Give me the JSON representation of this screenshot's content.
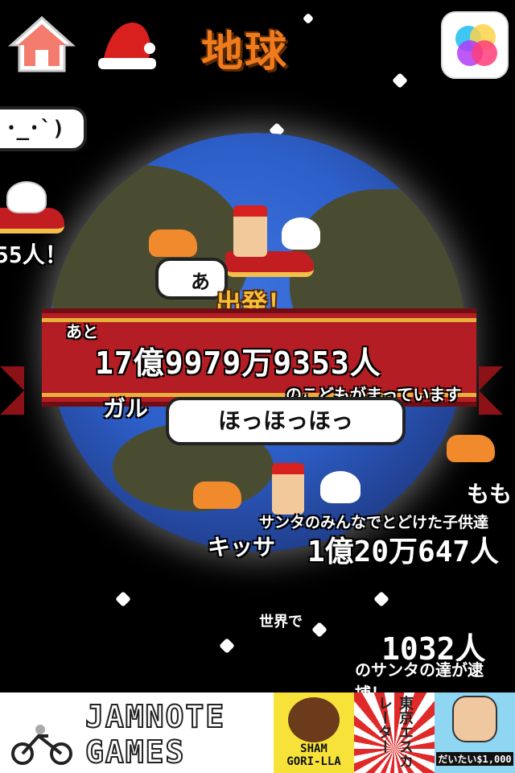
{
  "header": {
    "title": "地球",
    "home_icon": "house-icon",
    "santa_hat_icon": "santa-hat-icon",
    "game_center_icon": "game-center-icon"
  },
  "left_bubble": {
    "text": "･_･`)"
  },
  "left_count": {
    "text": "55人！"
  },
  "departure": {
    "text": "出発！",
    "bubble_partial": "あ"
  },
  "banner": {
    "prefix": "あと",
    "count": "17億9979万9353人",
    "suffix": "のこどもがまっています"
  },
  "speech_bubble": {
    "text": "ほっほっほっ"
  },
  "partial_name_left": "ガル",
  "partial_name_right": "もも",
  "delivered": {
    "label": "サンタのみんなでとどけた子供達",
    "name": "キッサ",
    "count": "1億20万647人"
  },
  "world": {
    "label": "世界で",
    "count": "1032人",
    "suffix": "のサンタの達が逮捕！"
  },
  "ads": {
    "jamnote_line1": "JAMNOTE",
    "jamnote_line2": "GAMES",
    "shamgorilla_line1": "SHAM",
    "shamgorilla_line2": "GORI-LLA",
    "third_text": "東京エスカレーター",
    "fourth_label": "だいたい$1,000"
  },
  "colors": {
    "ocean": "#2d5fc9",
    "land": "#4a4c32",
    "banner_red": "#b51d24",
    "title_orange": "#f07b1c"
  }
}
